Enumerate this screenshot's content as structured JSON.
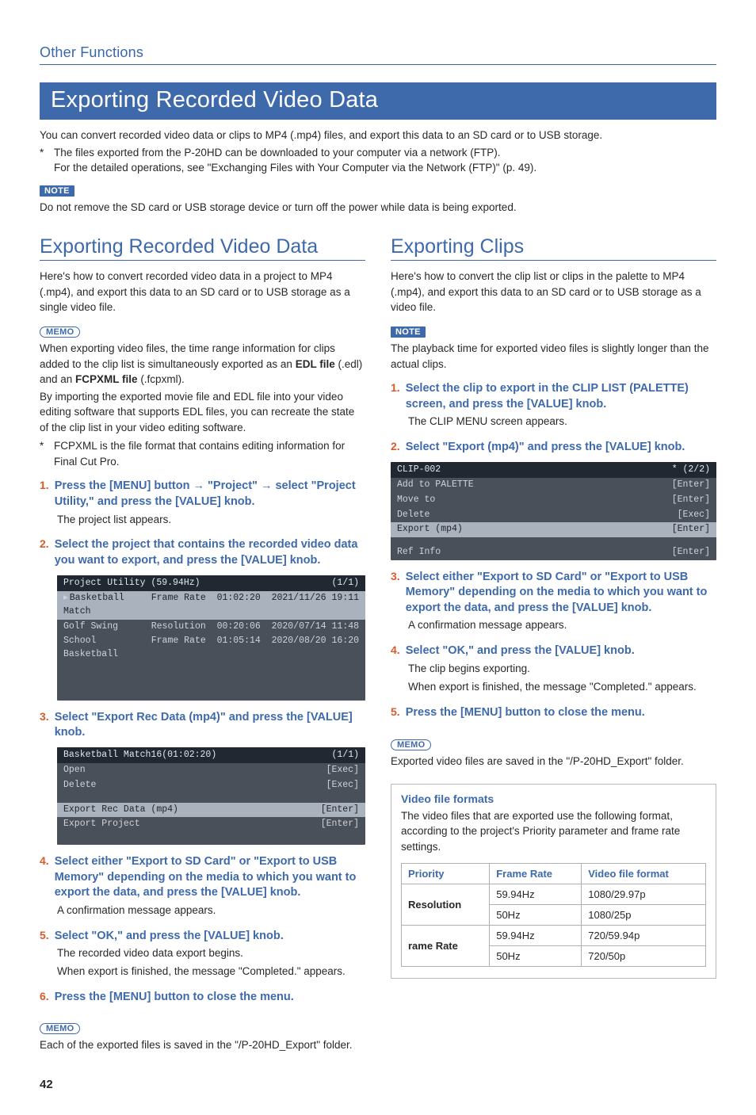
{
  "runningHead": "Other Functions",
  "pageTitle": "Exporting Recorded Video Data",
  "intro": "You can convert recorded video data or clips to MP4 (.mp4) files, and export this data to an SD card or to USB storage.",
  "starNote1": "The files exported from the P-20HD can be downloaded to your computer via a network (FTP).",
  "starNote1b": "For the detailed operations, see \"Exchanging Files with Your Computer via the Network (FTP)\" (p. 49).",
  "noteLabel": "NOTE",
  "noteText": "Do not remove the SD card or USB storage device or turn off the power while data is being exported.",
  "memoLabel": "MEMO",
  "left": {
    "h2": "Exporting Recorded Video Data",
    "intro": "Here's how to convert recorded video data in a project to MP4 (.mp4), and export this data to an SD card or to USB storage as a single video file.",
    "memo1a": "When exporting video files, the time range information for clips added to the clip list is simultaneously exported as an ",
    "memo1_bold1": "EDL file",
    "memo1b": " (.edl) and an ",
    "memo1_bold2": "FCPXML file",
    "memo1c": " (.fcpxml).",
    "memo2": "By importing the exported movie file and EDL file into your video editing software that supports EDL files, you can recreate the state of the clip list in your video editing software.",
    "memoStar": "FCPXML is the file format that contains editing information for Final Cut Pro.",
    "steps": [
      {
        "txt": "Press the [MENU] button → \"Project\" → select \"Project Utility,\" and press the [VALUE] knob.",
        "sub": "The project list appears."
      },
      {
        "txt": "Select the project that contains the recorded video data you want to export, and press the [VALUE] knob."
      },
      {
        "txt": "Select \"Export Rec Data (mp4)\" and press the [VALUE] knob."
      },
      {
        "txt": "Select either \"Export to SD Card\" or \"Export to USB Memory\" depending on the media to which you want to export the data, and press the [VALUE] knob.",
        "sub": "A confirmation message appears."
      },
      {
        "txt": "Select \"OK,\" and press the [VALUE] knob.",
        "sub": "The recorded video data export begins.",
        "sub2": "When export is finished, the message \"Completed.\" appears."
      },
      {
        "txt": "Press the [MENU] button to close the menu."
      }
    ],
    "memoBottom": "Each of the exported files is saved in the \"/P-20HD_Export\" folder.",
    "ss1": {
      "head_l": "Project Utility (59.94Hz)",
      "head_r": "(1/1)",
      "rows": [
        {
          "sel": true,
          "l": "Basketball Match",
          "r": "Frame Rate  01:02:20  2021/11/26 19:11",
          "arrow": true
        },
        {
          "l": " Golf Swing",
          "r": "Resolution  00:20:06  2020/07/14 11:48"
        },
        {
          "l": " School Basketball",
          "r": "Frame Rate  01:05:14  2020/08/20 16:20"
        }
      ]
    },
    "ss2": {
      "head_l": "Basketball Match16(01:02:20)",
      "head_r": "(1/1)",
      "rows": [
        {
          "l": " Open",
          "r": "[Exec]"
        },
        {
          "l": " Delete",
          "r": "[Exec]"
        }
      ],
      "rows2": [
        {
          "sel": true,
          "l": " Export Rec Data (mp4)",
          "r": "[Enter]"
        },
        {
          "l": " Export Project",
          "r": "[Enter]"
        }
      ]
    }
  },
  "right": {
    "h2": "Exporting Clips",
    "intro": "Here's how to convert the clip list or clips in the palette to MP4 (.mp4), and export this data to an SD card or to USB storage as a video file.",
    "noteText": "The playback time for exported video files is slightly longer than the actual clips.",
    "steps": [
      {
        "txt": "Select the clip to export in the CLIP LIST (PALETTE) screen, and press the [VALUE] knob.",
        "sub": "The CLIP MENU screen appears."
      },
      {
        "txt": "Select \"Export (mp4)\" and press the [VALUE] knob."
      },
      {
        "txt": "Select either \"Export to SD Card\" or \"Export to USB Memory\" depending on the media to which you want to export the data, and press the [VALUE] knob.",
        "sub": "A confirmation message appears."
      },
      {
        "txt": "Select \"OK,\" and press the [VALUE] knob.",
        "sub": "The clip begins exporting.",
        "sub2": "When export is finished, the message \"Completed.\" appears."
      },
      {
        "txt": "Press the [MENU] button to close the menu."
      }
    ],
    "memoBottom": "Exported video files are saved in the \"/P-20HD_Export\" folder.",
    "ss": {
      "head_l": "CLIP-002",
      "head_r": "*    (2/2)",
      "rows": [
        {
          "l": " Add to PALETTE",
          "r": "[Enter]"
        },
        {
          "l": " Move to",
          "r": "[Enter]"
        },
        {
          "l": " Delete",
          "r": "[Exec]"
        },
        {
          "sel": true,
          "l": " Export (mp4)",
          "r": "[Enter]"
        }
      ],
      "rows2": [
        {
          "l": " Ref Info",
          "r": "[Enter]"
        }
      ]
    },
    "formats": {
      "title": "Video file formats",
      "desc": "The video files that are exported use the following format, according to the project's Priority parameter and frame rate settings.",
      "headers": [
        "Priority",
        "Frame Rate",
        "Video file format"
      ],
      "rows": [
        {
          "pri": "Resolution",
          "rate": "59.94Hz",
          "fmt": "1080/29.97p"
        },
        {
          "pri": "",
          "rate": "50Hz",
          "fmt": "1080/25p"
        },
        {
          "pri": "rame Rate",
          "rate": "59.94Hz",
          "fmt": "720/59.94p"
        },
        {
          "pri": "",
          "rate": "50Hz",
          "fmt": "720/50p"
        }
      ]
    }
  },
  "pageNumber": "42"
}
